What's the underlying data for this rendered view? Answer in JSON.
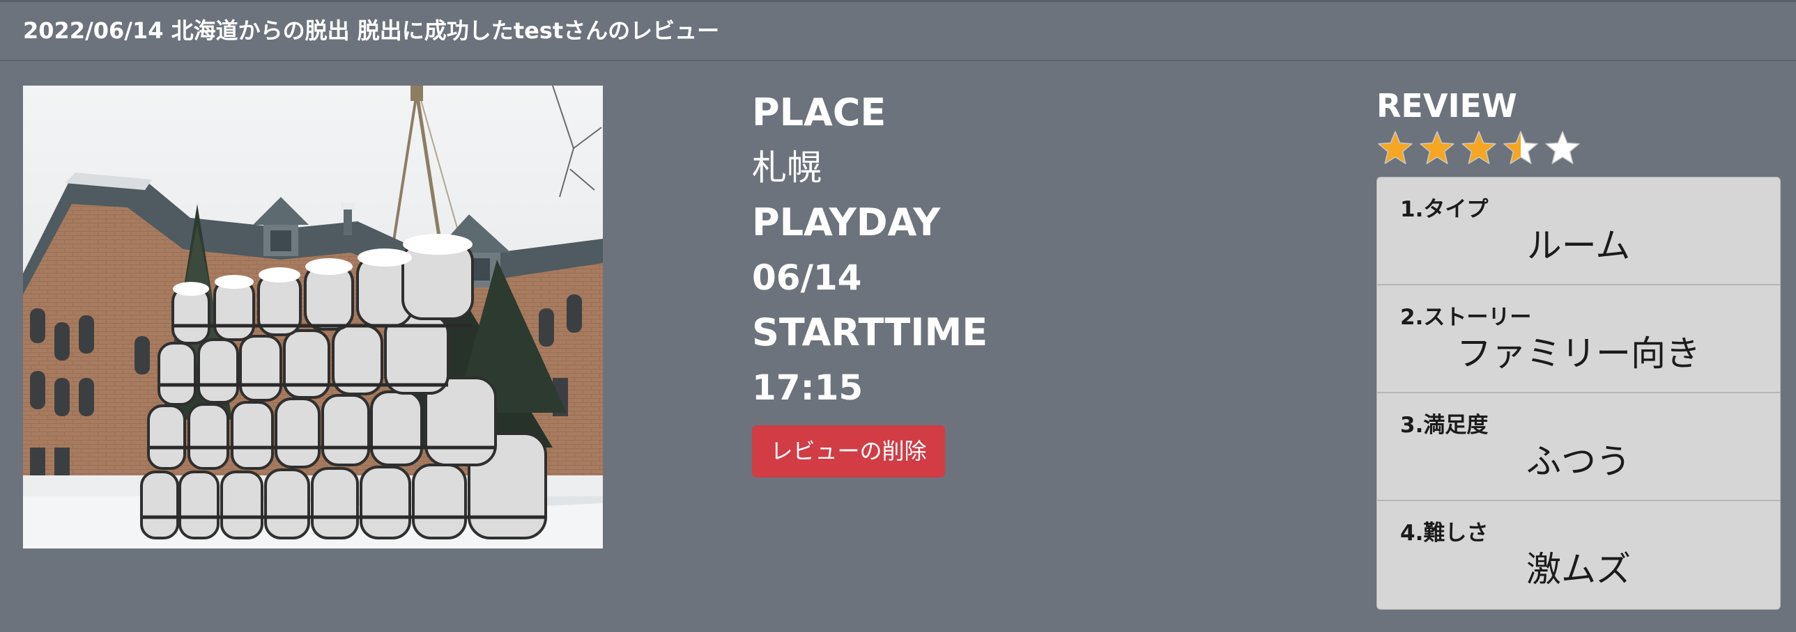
{
  "header": {
    "title": "2022/06/14 北海道からの脱出 脱出に成功したtestさんのレビュー"
  },
  "details": {
    "place_label": "PLACE",
    "place_value": "札幌",
    "playday_label": "PLAYDAY",
    "playday_value": "06/14",
    "starttime_label": "STARTTIME",
    "starttime_value": "17:15",
    "delete_button": "レビューの削除"
  },
  "review": {
    "title": "REVIEW",
    "rating": 3.5,
    "max_rating": 5,
    "star_color": "#f5a623",
    "empty_star_color": "#ffffff",
    "items": [
      {
        "label": "1.タイプ",
        "value": "ルーム"
      },
      {
        "label": "2.ストーリー",
        "value": "ファミリー向き"
      },
      {
        "label": "3.満足度",
        "value": "ふつう"
      },
      {
        "label": "4.難しさ",
        "value": "激ムズ"
      }
    ]
  },
  "colors": {
    "background": "#6c737c",
    "delete_button": "#d13c45",
    "panel": "#d6d6d6"
  }
}
